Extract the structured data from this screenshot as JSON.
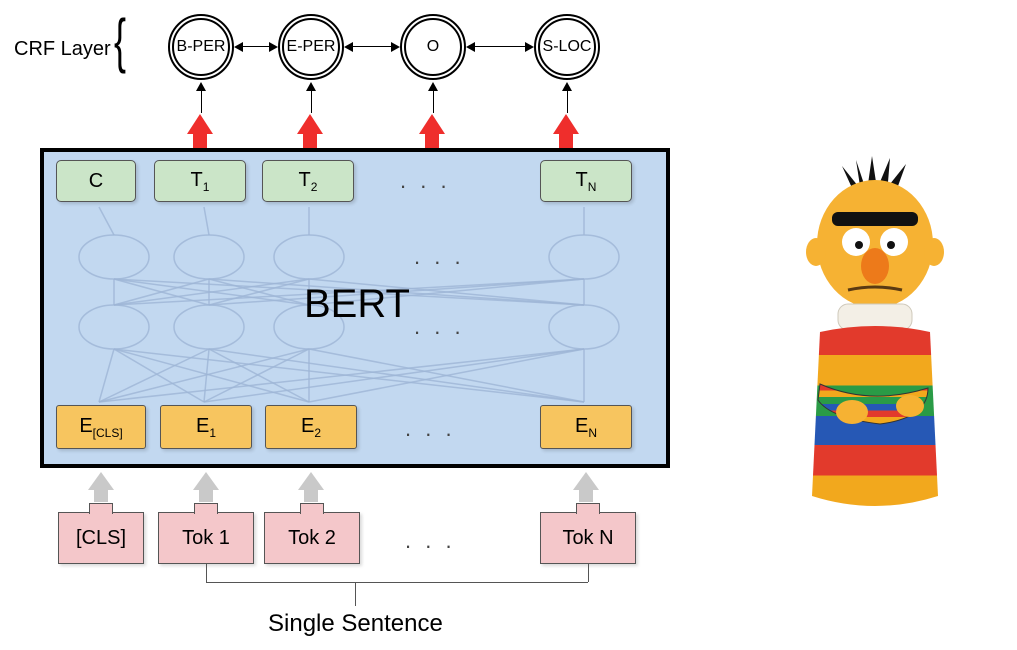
{
  "crf_layer_label": "CRF Layer",
  "crf_nodes": [
    "B-PER",
    "E-PER",
    "O",
    "S-LOC"
  ],
  "outputs": {
    "c": "C",
    "t1_pre": "T",
    "t1_sub": "1",
    "t2_pre": "T",
    "t2_sub": "2",
    "tn_pre": "T",
    "tn_sub": "N"
  },
  "embeddings": {
    "ecls_pre": "E",
    "ecls_sub": "[CLS]",
    "e1_pre": "E",
    "e1_sub": "1",
    "e2_pre": "E",
    "e2_sub": "2",
    "en_pre": "E",
    "en_sub": "N"
  },
  "tokens": {
    "cls": "[CLS]",
    "t1": "Tok 1",
    "t2": "Tok 2",
    "tn": "Tok N"
  },
  "bert_label": "BERT",
  "bottom_label": "Single Sentence",
  "ellipsis": ". . .",
  "character_alt": "Bert character illustration"
}
